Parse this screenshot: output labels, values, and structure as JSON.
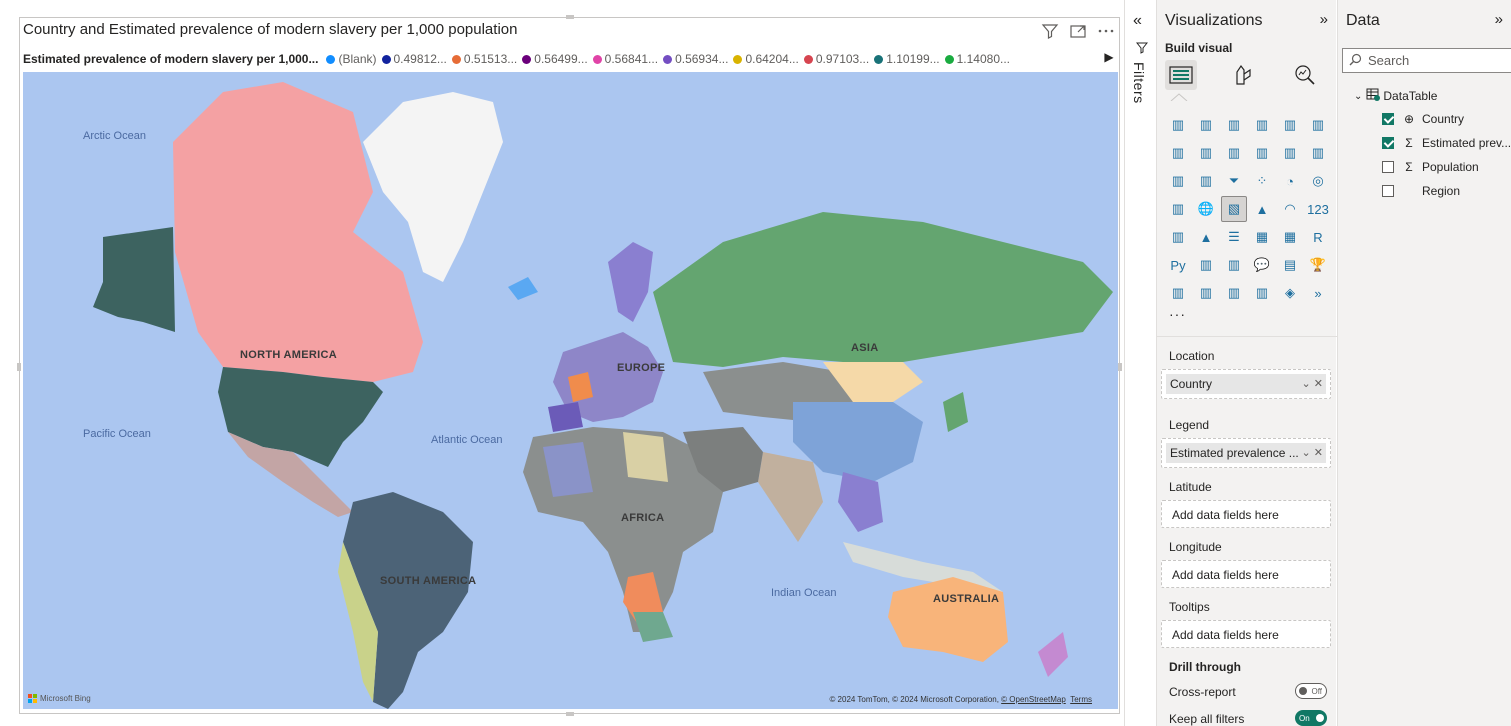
{
  "visual": {
    "title": "Country and Estimated prevalence of modern slavery per 1,000 population",
    "legend_title": "Estimated prevalence of modern slavery per 1,000...",
    "legend_items": [
      {
        "label": "(Blank)",
        "color": "#118dff"
      },
      {
        "label": "0.49812...",
        "color": "#12239e"
      },
      {
        "label": "0.51513...",
        "color": "#e66c37"
      },
      {
        "label": "0.56499...",
        "color": "#6b007b"
      },
      {
        "label": "0.56841...",
        "color": "#e044a7"
      },
      {
        "label": "0.56934...",
        "color": "#744ec2"
      },
      {
        "label": "0.64204...",
        "color": "#d9b300"
      },
      {
        "label": "0.97103...",
        "color": "#d64550"
      },
      {
        "label": "1.10199...",
        "color": "#197278"
      },
      {
        "label": "1.14080...",
        "color": "#1aab40"
      }
    ],
    "map_labels": {
      "arctic": "Arctic Ocean",
      "pacific": "Pacific Ocean",
      "atlantic": "Atlantic Ocean",
      "indian": "Indian Ocean",
      "north_america": "NORTH AMERICA",
      "south_america": "SOUTH AMERICA",
      "europe": "EUROPE",
      "africa": "AFRICA",
      "asia": "ASIA",
      "australia": "AUSTRALIA"
    },
    "bing_label": "Microsoft Bing",
    "attribution": "© 2024 TomTom, © 2024 Microsoft Corporation,",
    "osm_link": "© OpenStreetMap",
    "terms_link": "Terms"
  },
  "filters": {
    "label": "Filters"
  },
  "visualizations": {
    "title": "Visualizations",
    "build_visual": "Build visual",
    "wells": {
      "location_label": "Location",
      "location_value": "Country",
      "legend_label": "Legend",
      "legend_value": "Estimated prevalence ...",
      "latitude_label": "Latitude",
      "longitude_label": "Longitude",
      "tooltips_label": "Tooltips",
      "placeholder": "Add data fields here",
      "drill_label": "Drill through",
      "cross_report": "Cross-report",
      "cross_state": "Off",
      "keep_filters": "Keep all filters",
      "keep_state": "On"
    },
    "gallery_icons": [
      "stacked-bar-icon",
      "stacked-column-icon",
      "clustered-bar-icon",
      "clustered-column-icon",
      "100-bar-icon",
      "100-column-icon",
      "line-icon",
      "area-icon",
      "stacked-area-icon",
      "ribbon-icon",
      "waterfall-icon",
      "line-column-icon",
      "line-clustered-icon",
      "waterfall2-icon",
      "funnel-icon",
      "scatter-icon",
      "pie-icon",
      "donut-icon",
      "treemap-icon",
      "map-icon",
      "filled-map-icon",
      "azure-map-icon",
      "gauge-icon",
      "card-icon",
      "multirow-card-icon",
      "kpi-icon",
      "slicer-icon",
      "table-icon",
      "matrix-icon",
      "r-visual-icon",
      "python-visual-icon",
      "key-influencers-icon",
      "decomposition-icon",
      "qa-icon",
      "narrative-icon",
      "goals-icon",
      "paginated-icon",
      "power-apps-icon",
      "power-automate-icon",
      "arcgis-icon",
      "diamond-icon",
      "chevrons-icon"
    ]
  },
  "data_pane": {
    "title": "Data",
    "search_placeholder": "Search",
    "table": "DataTable",
    "fields": [
      {
        "label": "Country",
        "checked": true,
        "icon": "globe"
      },
      {
        "label": "Estimated prev...",
        "checked": true,
        "icon": "sigma"
      },
      {
        "label": "Population",
        "checked": false,
        "icon": "sigma"
      },
      {
        "label": "Region",
        "checked": false,
        "icon": ""
      }
    ]
  }
}
